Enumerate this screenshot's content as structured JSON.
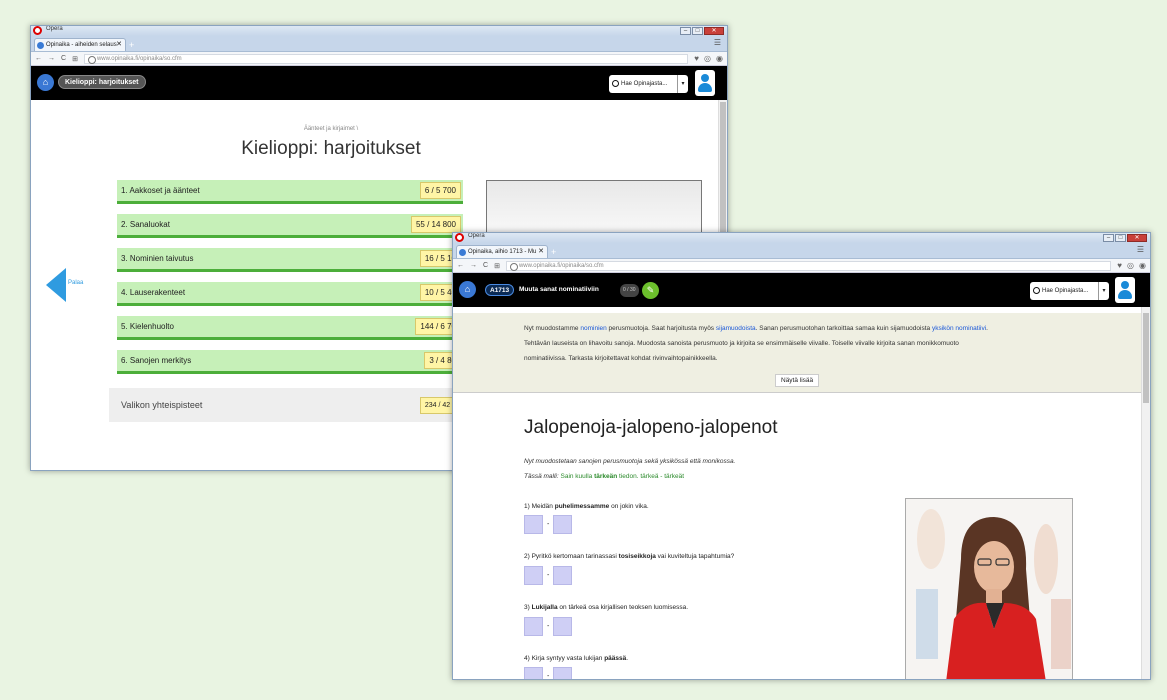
{
  "window1": {
    "app_name": "Opera",
    "tab_title": "Opinaika - aiheiden selaus",
    "url": "www.opinaika.fi/opinaika/so.cfm",
    "nav_pill": "Kielioppi: harjoitukset",
    "search_placeholder": "Hae Opinajasta...",
    "breadcrumb": "Äänteet ja kirjaimet \\",
    "page_title": "Kielioppi: harjoitukset",
    "back_label": "Palaa",
    "menu": [
      {
        "label": "1. Aakkoset ja äänteet",
        "score": "6 / 5 700"
      },
      {
        "label": "2. Sanaluokat",
        "score": "55 / 14 800"
      },
      {
        "label": "3. Nominien taivutus",
        "score": "16 / 5 10"
      },
      {
        "label": "4. Lauserakenteet",
        "score": "10 / 5 40"
      },
      {
        "label": "5. Kielenhuolto",
        "score": "144 / 6 70"
      },
      {
        "label": "6. Sanojen merkitys",
        "score": "3 / 4 80"
      }
    ],
    "total_label": "Valikon yhteispisteet",
    "total_score": "234 / 42 5"
  },
  "window2": {
    "app_name": "Opera",
    "tab_title": "Opinaika, aihio 1713 - Mu",
    "url": "www.opinaika.fi/opinaika/so.cfm",
    "task_code": "A1713",
    "task_name": "Muuta sanat nominatiiviin",
    "task_count": "0 / 30",
    "search_placeholder": "Hae Opinajasta...",
    "intro": {
      "p1_a": "Nyt muodostamme ",
      "p1_link1": "nominien",
      "p1_b": " perusmuotoja. Saat harjoitusta myös ",
      "p1_link2": "sijamuodoista",
      "p1_c": ". Sanan perusmuotohan tarkoittaa samaa kuin sijamuodoista ",
      "p1_link3": "yksikön nominatiivi",
      "p1_d": ".",
      "line2": "Tehtävän lauseista on lihavoitu sanoja. Muodosta sanoista perusmuoto ja kirjoita se ensimmäiselle viivalle. Toiselle viivalle kirjoita sanan monikkomuoto",
      "line3": "nominatiivissa. Tarkasta kirjoitettavat kohdat rivinvaihtopainikkeella."
    },
    "more_button": "Näytä lisää",
    "title": "Jalopenoja-jalopeno-jalopenot",
    "subtitle": "Nyt muodostetaan sanojen perusmuotoja sekä yksikössä että monikossa.",
    "model_prefix": "Tässä malli:",
    "model_a": " Sain kuulla ",
    "model_bold": "tärkeän",
    "model_b": " tiedon. tärkeä - tärkeät",
    "questions": [
      {
        "pre": "1) Meidän ",
        "bold": "puhelimessamme",
        "post": " on jokin vika."
      },
      {
        "pre": "2) Pyritkö kertomaan tarinassasi ",
        "bold": "tosiseikkoja",
        "post": " vai kuviteltuja tapahtumia?"
      },
      {
        "pre": "3) ",
        "bold": "Lukijalla",
        "post": " on tärkeä osa kirjallisen teoksen luomisessa."
      },
      {
        "pre": "4) Kirja syntyy vasta lukijan ",
        "bold": "päässä",
        "post": "."
      }
    ],
    "dash": "-"
  }
}
